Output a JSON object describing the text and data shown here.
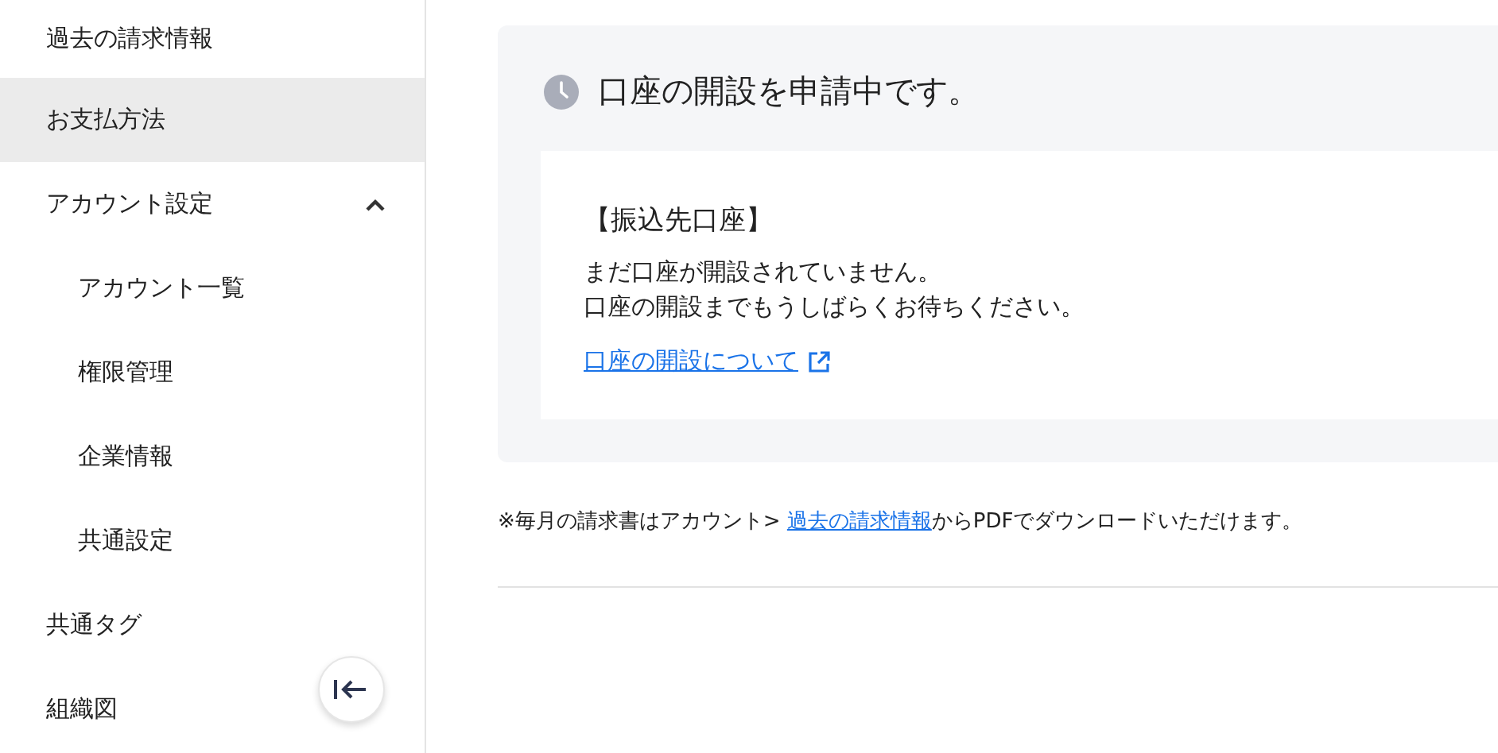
{
  "sidebar": {
    "items": [
      {
        "label": "過去の請求情報",
        "selected": false
      },
      {
        "label": "お支払方法",
        "selected": true
      },
      {
        "label": "アカウント設定",
        "selected": false,
        "expanded": true,
        "children": [
          {
            "label": "アカウント一覧",
            "selected": false
          },
          {
            "label": "権限管理",
            "selected": false
          },
          {
            "label": "企業情報",
            "selected": false
          },
          {
            "label": "共通設定",
            "selected": false
          }
        ]
      },
      {
        "label": "共通タグ",
        "selected": false
      },
      {
        "label": "組織図",
        "selected": false
      }
    ]
  },
  "status_card": {
    "title": "口座の開設を申請中です。",
    "heading": "【振込先口座】",
    "lines": [
      "まだ口座が開設されていません。",
      "口座の開設までもうしばらくお待ちください。"
    ],
    "link": "口座の開設について"
  },
  "note": {
    "before": "※毎月の請求書はアカウント> ",
    "link": "過去の請求情報",
    "after": "からPDFでダウンロードいただけます。"
  }
}
